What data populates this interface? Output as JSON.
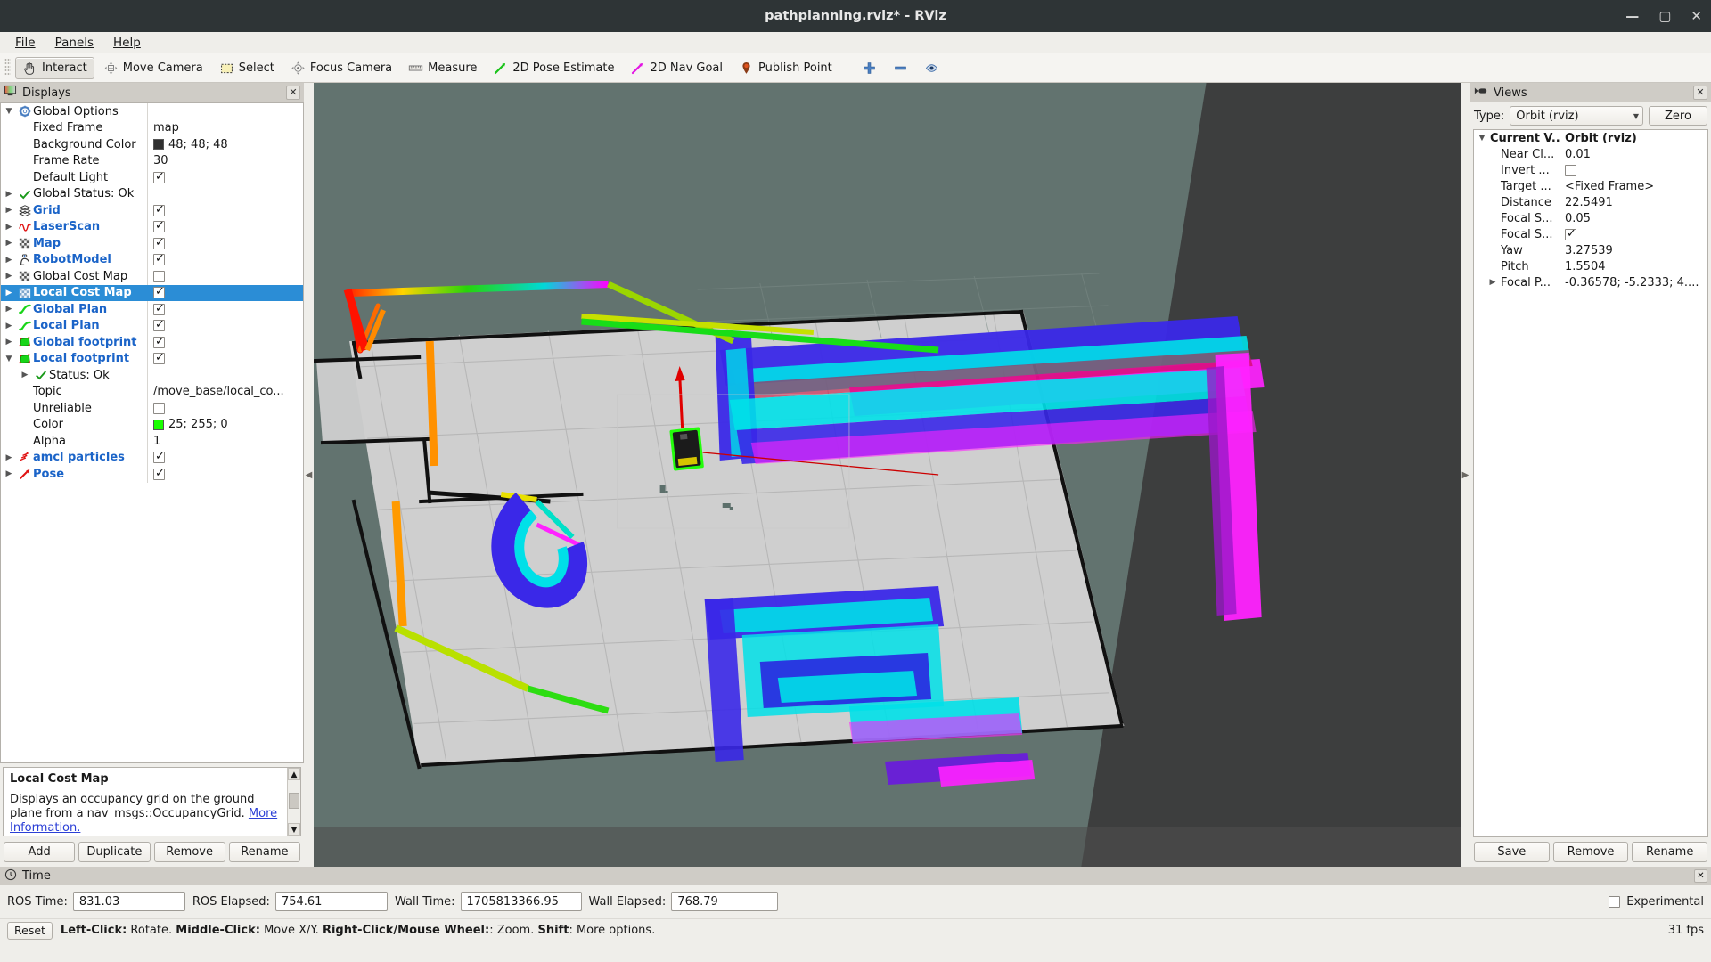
{
  "window": {
    "title": "pathplanning.rviz* - RViz",
    "minimize": "—",
    "maximize": "▢",
    "close": "✕"
  },
  "menu": [
    {
      "label": "File"
    },
    {
      "label": "Panels"
    },
    {
      "label": "Help"
    }
  ],
  "toolbar": {
    "buttons": [
      {
        "label": "Interact",
        "icon": "hand-icon",
        "active": true
      },
      {
        "label": "Move Camera",
        "icon": "move-camera-icon",
        "active": false
      },
      {
        "label": "Select",
        "icon": "select-rect-icon",
        "active": false
      },
      {
        "label": "Focus Camera",
        "icon": "focus-camera-icon",
        "active": false
      },
      {
        "label": "Measure",
        "icon": "ruler-icon",
        "active": false
      },
      {
        "label": "2D Pose Estimate",
        "icon": "green-arrow-icon",
        "active": false
      },
      {
        "label": "2D Nav Goal",
        "icon": "magenta-arrow-icon",
        "active": false
      },
      {
        "label": "Publish Point",
        "icon": "map-pin-icon",
        "active": false
      }
    ],
    "zoom_in": "plus-icon",
    "zoom_out": "minus-icon",
    "visibility": "eye-icon"
  },
  "displays": {
    "title": "Displays",
    "close": "✕",
    "rows": [
      {
        "arrow": "▼",
        "icon": "gear-icon",
        "name": "Global Options",
        "style": "plain-bold",
        "indent": 0,
        "value": "",
        "value_type": "none"
      },
      {
        "arrow": "",
        "icon": "",
        "name": "Fixed Frame",
        "style": "plain",
        "indent": 1,
        "value": "map",
        "value_type": "text"
      },
      {
        "arrow": "",
        "icon": "",
        "name": "Background Color",
        "style": "plain",
        "indent": 1,
        "value": "48; 48; 48",
        "value_type": "color",
        "color": "#303030"
      },
      {
        "arrow": "",
        "icon": "",
        "name": "Frame Rate",
        "style": "plain",
        "indent": 1,
        "value": "30",
        "value_type": "text"
      },
      {
        "arrow": "",
        "icon": "",
        "name": "Default Light",
        "style": "plain",
        "indent": 1,
        "value": "",
        "value_type": "checkbox",
        "checked": true
      },
      {
        "arrow": "▶",
        "icon": "check-icon",
        "name": "Global Status: Ok",
        "style": "plain",
        "indent": 0,
        "value": "",
        "value_type": "none"
      },
      {
        "arrow": "▶",
        "icon": "grid-icon",
        "name": "Grid",
        "style": "blue",
        "indent": 0,
        "value": "",
        "value_type": "checkbox",
        "checked": true
      },
      {
        "arrow": "▶",
        "icon": "laserscan-icon",
        "name": "LaserScan",
        "style": "blue",
        "indent": 0,
        "value": "",
        "value_type": "checkbox",
        "checked": true
      },
      {
        "arrow": "▶",
        "icon": "map-icon",
        "name": "Map",
        "style": "blue",
        "indent": 0,
        "value": "",
        "value_type": "checkbox",
        "checked": true
      },
      {
        "arrow": "▶",
        "icon": "robotmodel-icon",
        "name": "RobotModel",
        "style": "blue",
        "indent": 0,
        "value": "",
        "value_type": "checkbox",
        "checked": true
      },
      {
        "arrow": "▶",
        "icon": "map-icon",
        "name": "Global Cost Map",
        "style": "plain",
        "indent": 0,
        "value": "",
        "value_type": "checkbox",
        "checked": false
      },
      {
        "arrow": "▶",
        "icon": "costmap-icon",
        "name": "Local Cost Map",
        "style": "blue",
        "indent": 0,
        "value": "",
        "value_type": "checkbox",
        "checked": true,
        "selected": true
      },
      {
        "arrow": "▶",
        "icon": "path-icon",
        "name": "Global Plan",
        "style": "blue",
        "indent": 0,
        "value": "",
        "value_type": "checkbox",
        "checked": true
      },
      {
        "arrow": "▶",
        "icon": "path-icon",
        "name": "Local Plan",
        "style": "blue",
        "indent": 0,
        "value": "",
        "value_type": "checkbox",
        "checked": true
      },
      {
        "arrow": "▶",
        "icon": "polygon-icon",
        "name": "Global footprint",
        "style": "blue",
        "indent": 0,
        "value": "",
        "value_type": "checkbox",
        "checked": true
      },
      {
        "arrow": "▼",
        "icon": "polygon-icon",
        "name": "Local footprint",
        "style": "blue",
        "indent": 0,
        "value": "",
        "value_type": "checkbox",
        "checked": true
      },
      {
        "arrow": "▶",
        "icon": "check-icon",
        "name": "Status: Ok",
        "style": "plain",
        "indent": 2,
        "value": "",
        "value_type": "none"
      },
      {
        "arrow": "",
        "icon": "",
        "name": "Topic",
        "style": "plain",
        "indent": 1,
        "value": "/move_base/local_co...",
        "value_type": "text"
      },
      {
        "arrow": "",
        "icon": "",
        "name": "Unreliable",
        "style": "plain",
        "indent": 1,
        "value": "",
        "value_type": "checkbox",
        "checked": false
      },
      {
        "arrow": "",
        "icon": "",
        "name": "Color",
        "style": "plain",
        "indent": 1,
        "value": "25; 255; 0",
        "value_type": "color",
        "color": "#19ff00"
      },
      {
        "arrow": "",
        "icon": "",
        "name": "Alpha",
        "style": "plain",
        "indent": 1,
        "value": "1",
        "value_type": "text"
      },
      {
        "arrow": "▶",
        "icon": "particles-icon",
        "name": "amcl particles",
        "style": "blue",
        "indent": 0,
        "value": "",
        "value_type": "checkbox",
        "checked": true
      },
      {
        "arrow": "▶",
        "icon": "pose-icon",
        "name": "Pose",
        "style": "blue",
        "indent": 0,
        "value": "",
        "value_type": "checkbox",
        "checked": true
      }
    ],
    "description": {
      "heading": "Local Cost Map",
      "body": "Displays an occupancy grid on the ground plane from a nav_msgs::OccupancyGrid. ",
      "link": "More Information."
    },
    "buttons": [
      {
        "label": "Add"
      },
      {
        "label": "Duplicate"
      },
      {
        "label": "Remove"
      },
      {
        "label": "Rename"
      }
    ]
  },
  "views": {
    "title": "Views",
    "close": "✕",
    "type_label": "Type:",
    "type_value": "Orbit (rviz)",
    "zero_label": "Zero",
    "rows": [
      {
        "arrow": "▼",
        "name": "Current V...",
        "value": "Orbit (rviz)",
        "bold": true,
        "value_type": "text",
        "indent": 0
      },
      {
        "arrow": "",
        "name": "Near Cl...",
        "value": "0.01",
        "bold": false,
        "value_type": "text",
        "indent": 1
      },
      {
        "arrow": "",
        "name": "Invert ...",
        "value": "",
        "bold": false,
        "value_type": "checkbox",
        "checked": false,
        "indent": 1
      },
      {
        "arrow": "",
        "name": "Target ...",
        "value": "<Fixed Frame>",
        "bold": false,
        "value_type": "text",
        "indent": 1
      },
      {
        "arrow": "",
        "name": "Distance",
        "value": "22.5491",
        "bold": false,
        "value_type": "text",
        "indent": 1
      },
      {
        "arrow": "",
        "name": "Focal S...",
        "value": "0.05",
        "bold": false,
        "value_type": "text",
        "indent": 1
      },
      {
        "arrow": "",
        "name": "Focal S...",
        "value": "",
        "bold": false,
        "value_type": "checkbox",
        "checked": true,
        "indent": 1
      },
      {
        "arrow": "",
        "name": "Yaw",
        "value": "3.27539",
        "bold": false,
        "value_type": "text",
        "indent": 1
      },
      {
        "arrow": "",
        "name": "Pitch",
        "value": "1.5504",
        "bold": false,
        "value_type": "text",
        "indent": 1
      },
      {
        "arrow": "▶",
        "name": "Focal P...",
        "value": "-0.36578; -5.2333; 4....",
        "bold": false,
        "value_type": "text",
        "indent": 1
      }
    ],
    "buttons": [
      {
        "label": "Save"
      },
      {
        "label": "Remove"
      },
      {
        "label": "Rename"
      }
    ]
  },
  "time": {
    "title": "Time",
    "close": "✕",
    "fields": [
      {
        "label": "ROS Time:",
        "value": "831.03"
      },
      {
        "label": "ROS Elapsed:",
        "value": "754.61"
      },
      {
        "label": "Wall Time:",
        "value": "1705813366.95"
      },
      {
        "label": "Wall Elapsed:",
        "value": "768.79"
      }
    ],
    "experimental_label": "Experimental",
    "experimental_checked": false
  },
  "status": {
    "reset_label": "Reset",
    "hint_parts": [
      {
        "text": "Left-Click:",
        "bold": true
      },
      {
        "text": " Rotate. ",
        "bold": false
      },
      {
        "text": "Middle-Click:",
        "bold": true
      },
      {
        "text": " Move X/Y. ",
        "bold": false
      },
      {
        "text": "Right-Click/Mouse Wheel:",
        "bold": true
      },
      {
        "text": ": Zoom. ",
        "bold": false
      },
      {
        "text": "Shift",
        "bold": true
      },
      {
        "text": ": More options.",
        "bold": false
      }
    ],
    "fps": "31 fps"
  },
  "viewport": {
    "background_color": "#62736f",
    "dark_band_color": "#3b3b3b",
    "map_free_color": "#cfcfcf",
    "robot_color": "#1b1b1b",
    "footprint_color": "#19ff00",
    "pose_arrow_color": "#e00000"
  }
}
